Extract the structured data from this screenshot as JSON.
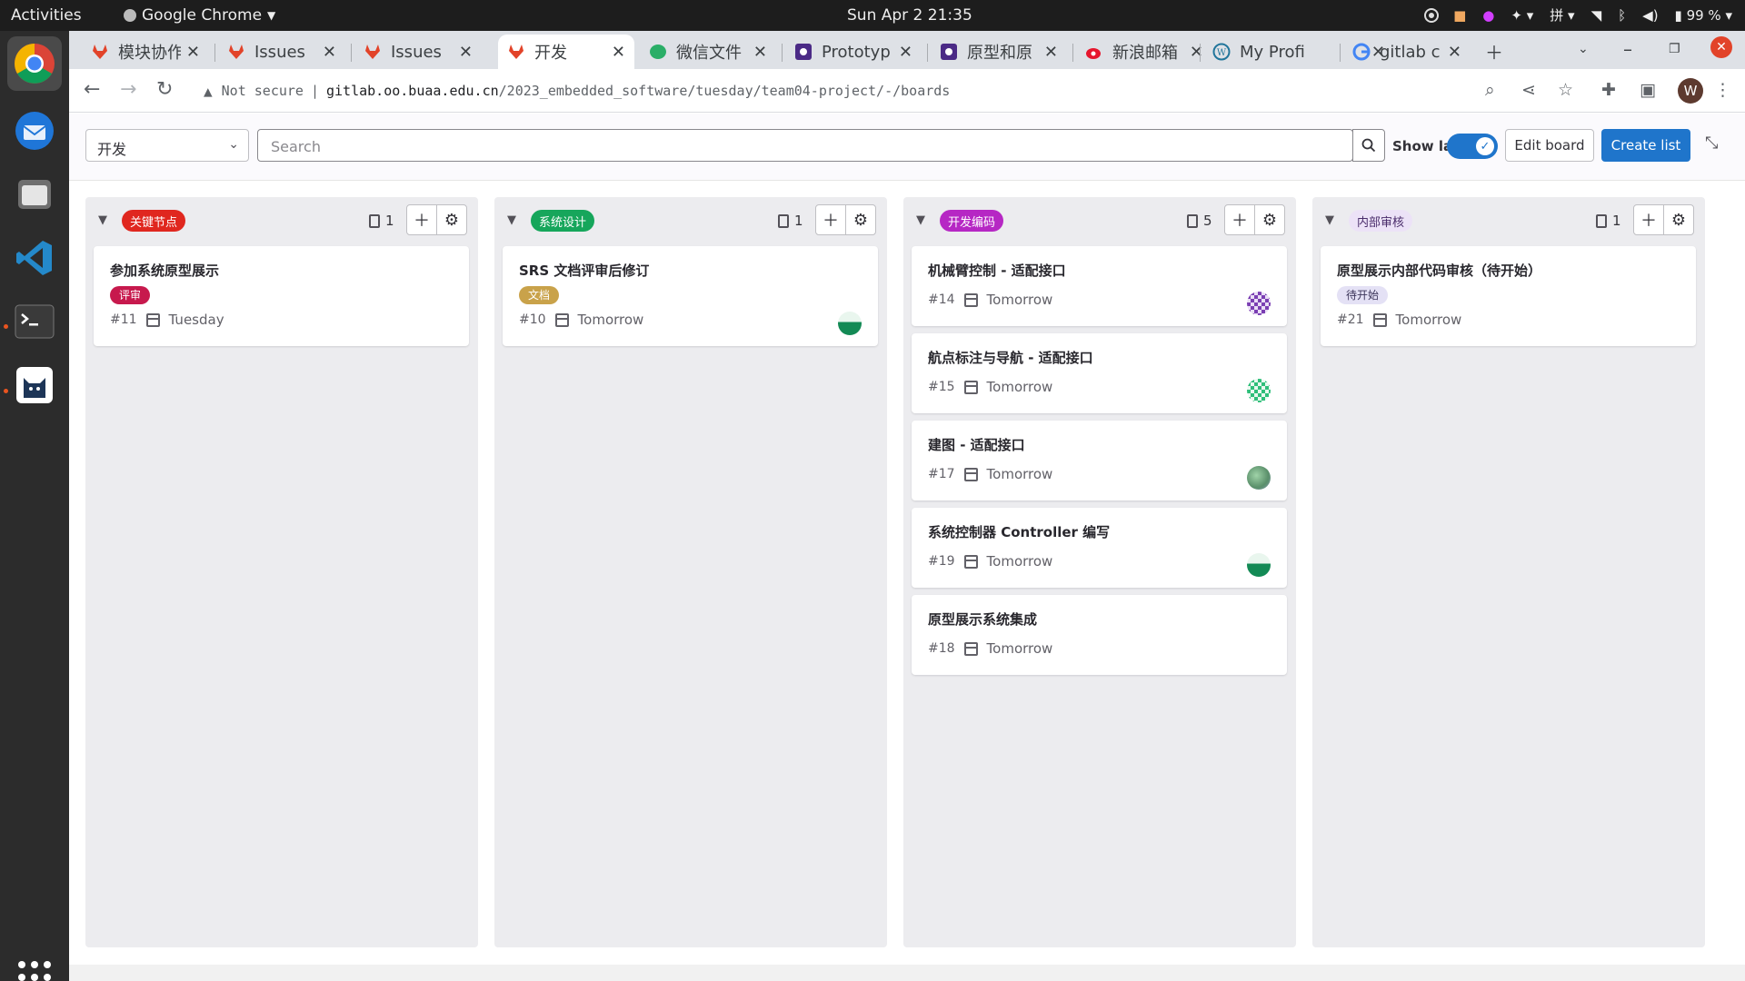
{
  "os": {
    "activities": "Activities",
    "app_name": "Google Chrome",
    "clock": "Sun Apr 2  21:35",
    "input_method": "拼",
    "battery": "99 %"
  },
  "tabs": [
    {
      "title": "模块协作",
      "icon": "gitlab-icon"
    },
    {
      "title": "Issues",
      "icon": "gitlab-icon"
    },
    {
      "title": "Issues",
      "icon": "gitlab-icon"
    },
    {
      "title": "开发",
      "icon": "gitlab-icon",
      "active": true
    },
    {
      "title": "微信文件",
      "icon": "wechat-icon"
    },
    {
      "title": "Prototyp",
      "icon": "prototype-icon"
    },
    {
      "title": "原型和原",
      "icon": "prototype-icon"
    },
    {
      "title": "新浪邮箱",
      "icon": "weibo-icon"
    },
    {
      "title": "My Profi",
      "icon": "wordpress-icon"
    },
    {
      "title": "gitlab c",
      "icon": "google-icon"
    }
  ],
  "address": {
    "security": "Not secure",
    "host": "gitlab.oo.buaa.edu.cn",
    "path": "/2023_embedded_software/tuesday/team04-project/-/boards"
  },
  "profile_initial": "W",
  "filter": {
    "board": "开发",
    "search_placeholder": "Search",
    "show_labels": "Show labels",
    "edit_board": "Edit board",
    "create_list": "Create list"
  },
  "lists": [
    {
      "label": "关键节点",
      "label_color": "#e0271f",
      "count": "1",
      "cards": [
        {
          "title": "参加系统原型展示",
          "label": "评审",
          "label_bg": "#c7194d",
          "label_fg": "#ffffff",
          "number": "#11",
          "due": "Tuesday",
          "avatar": ""
        }
      ]
    },
    {
      "label": "系统设计",
      "label_color": "#16a65b",
      "count": "1",
      "cards": [
        {
          "title": "SRS 文档评审后修订",
          "label": "文档",
          "label_bg": "#c9a24a",
          "label_fg": "#ffffff",
          "number": "#10",
          "due": "Tomorrow",
          "avatar": "green"
        }
      ]
    },
    {
      "label": "开发编码",
      "label_color": "#b627c4",
      "count": "5",
      "cards": [
        {
          "title": "机械臂控制 - 适配接口",
          "label": "",
          "number": "#14",
          "due": "Tomorrow",
          "avatar": "purple"
        },
        {
          "title": "航点标注与导航 - 适配接口",
          "label": "",
          "number": "#15",
          "due": "Tomorrow",
          "avatar": "mint"
        },
        {
          "title": "建图 - 适配接口",
          "label": "",
          "number": "#17",
          "due": "Tomorrow",
          "avatar": "photo"
        },
        {
          "title": "系统控制器 Controller 编写",
          "label": "",
          "number": "#19",
          "due": "Tomorrow",
          "avatar": "green"
        },
        {
          "title": "原型展示系统集成",
          "label": "",
          "number": "#18",
          "due": "Tomorrow",
          "avatar": ""
        }
      ]
    },
    {
      "label": "内部审核",
      "label_color": "#ece2f7",
      "label_fg": "#4a2c6b",
      "count": "1",
      "cards": [
        {
          "title": "原型展示内部代码审核（待开始）",
          "label": "待开始",
          "label_bg": "#e4e1f5",
          "label_fg": "#3b3459",
          "number": "#21",
          "due": "Tomorrow",
          "avatar": ""
        }
      ]
    }
  ]
}
